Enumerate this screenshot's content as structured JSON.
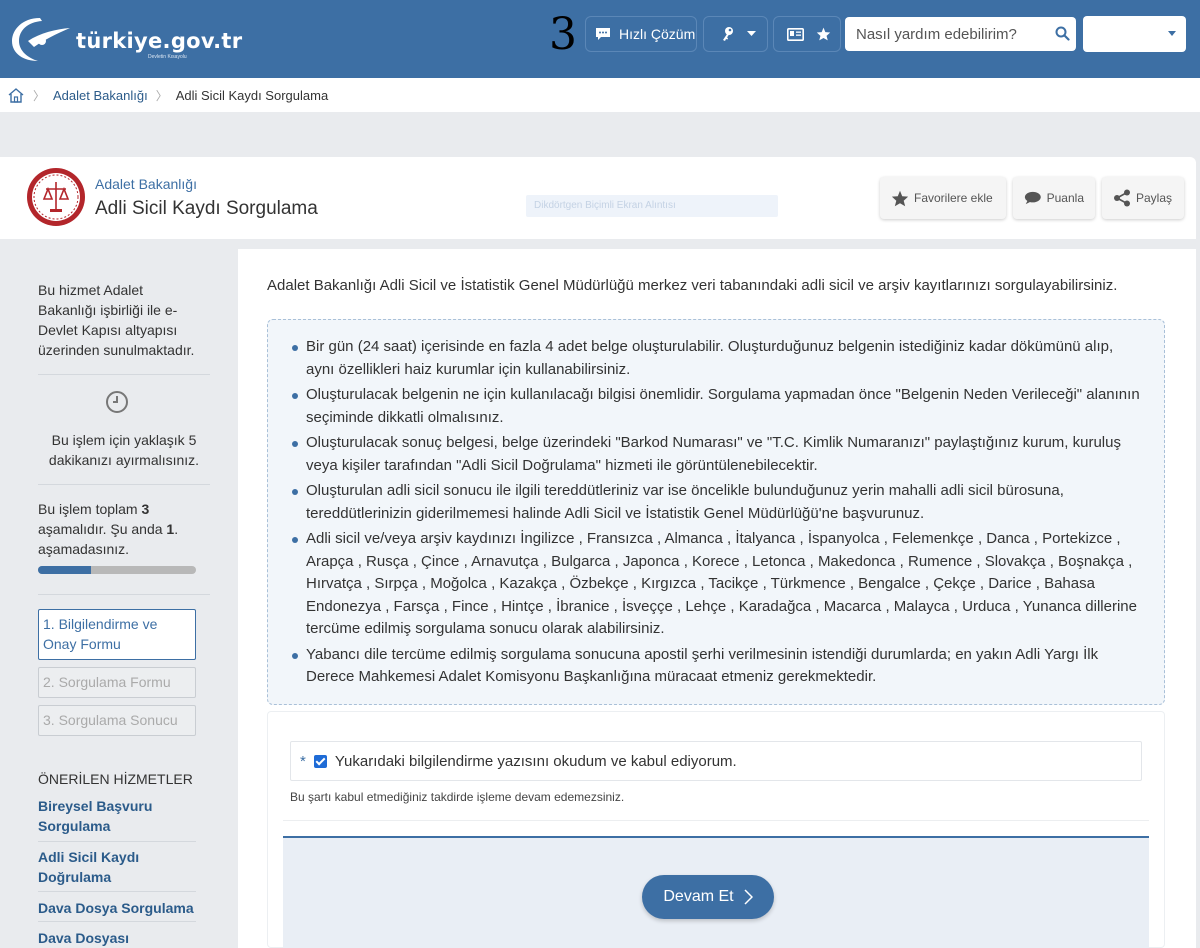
{
  "topbar": {
    "logo_text": "türkiye.gov.tr",
    "logo_sub": "Devletin Kısayolu",
    "number": "3",
    "quick_label": "Hızlı Çözüm",
    "search_placeholder": "Nasıl yardım edebilirim?",
    "login_label": ""
  },
  "breadcrumb": {
    "items": [
      "Adalet Bakanlığı",
      "Adli Sicil Kaydı Sorgulama"
    ]
  },
  "header": {
    "agency": "Adalet Bakanlığı",
    "title": "Adli Sicil Kaydı Sorgulama",
    "ghost_text": "Dikdörtgen Biçimli Ekran Alıntısı",
    "favorite_label": "Favorilere ekle",
    "rate_label": "Puanla",
    "share_label": "Paylaş"
  },
  "sidebar": {
    "service_info": "Bu hizmet Adalet Bakanlığı işbirliği ile e-Devlet Kapısı altyapısı üzerinden sunulmaktadır.",
    "time_info": "Bu işlem için yaklaşık 5 dakikanızı ayırmalısınız.",
    "stage_prefix": "Bu işlem toplam ",
    "stage_total": "3",
    "stage_middle": " aşamalıdır. Şu anda ",
    "stage_current": "1",
    "stage_suffix": ". aşamadasınız.",
    "progress_fraction": 0.333,
    "steps": [
      "1. Bilgilendirme ve Onay Formu",
      "2. Sorgulama Formu",
      "3. Sorgulama Sonucu"
    ],
    "recommended_title": "ÖNERİLEN HİZMETLER",
    "recommended": [
      "Bireysel Başvuru Sorgulama",
      "Adli Sicil Kaydı Doğrulama",
      "Dava Dosya Sorgulama",
      "Dava Dosyası Sorgulama"
    ]
  },
  "main": {
    "intro": "Adalet Bakanlığı Adli Sicil ve İstatistik Genel Müdürlüğü merkez veri tabanındaki adli sicil ve arşiv kayıtlarınızı sorgulayabilirsiniz.",
    "bullets": [
      "Bir gün (24 saat) içerisinde en fazla 4 adet belge oluşturulabilir. Oluşturduğunuz belgenin istediğiniz kadar dökümünü alıp, aynı özellikleri haiz kurumlar için kullanabilirsiniz.",
      "Oluşturulacak belgenin ne için kullanılacağı bilgisi önemlidir. Sorgulama yapmadan önce \"Belgenin Neden Verileceği\" alanının seçiminde dikkatli olmalısınız.",
      "Oluşturulacak sonuç belgesi, belge üzerindeki \"Barkod Numarası\" ve \"T.C. Kimlik Numaranızı\" paylaştığınız kurum, kuruluş veya kişiler tarafından \"Adli Sicil Doğrulama\" hizmeti ile görüntülenebilecektir.",
      "Oluşturulan adli sicil sonucu ile ilgili tereddütleriniz var ise öncelikle bulunduğunuz yerin mahalli adli sicil bürosuna, tereddütlerinizin giderilmemesi halinde Adli Sicil ve İstatistik Genel Müdürlüğü'ne başvurunuz.",
      "Adli sicil ve/veya arşiv kaydınızı İngilizce , Fransızca , Almanca , İtalyanca , İspanyolca , Felemenkçe , Danca , Portekizce , Arapça , Rusça , Çince , Arnavutça , Bulgarca , Japonca , Korece , Letonca , Makedonca , Rumence , Slovakça , Boşnakça , Hırvatça , Sırpça , Moğolca , Kazakça , Özbekçe , Kırgızca , Tacikçe , Türkmence , Bengalce , Çekçe , Darice , Bahasa Endonezya , Farsça , Fince , Hintçe , İbranice , İsveççe , Lehçe , Karadağca , Macarca , Malayca , Urduca , Yunanca dillerine tercüme edilmiş sorgulama sonucu olarak alabilirsiniz.",
      "Yabancı dile tercüme edilmiş sorgulama sonucuna apostil şerhi verilmesinin istendiği durumlarda; en yakın Adli Yargı İlk Derece Mahkemesi Adalet Komisyonu Başkanlığına müracaat etmeniz gerekmektedir."
    ],
    "required_mark": "*",
    "consent_label": "Yukarıdaki bilgilendirme yazısını okudum ve kabul ediyorum.",
    "consent_checked": true,
    "consent_note": "Bu şartı kabul etmediğiniz takdirde işleme devam edemezsiniz.",
    "continue_label": "Devam Et"
  },
  "colors": {
    "brand": "#3d6fa4",
    "link": "#2b5b8a",
    "background": "#e9ebee",
    "checkbox": "#1e6bd6"
  }
}
